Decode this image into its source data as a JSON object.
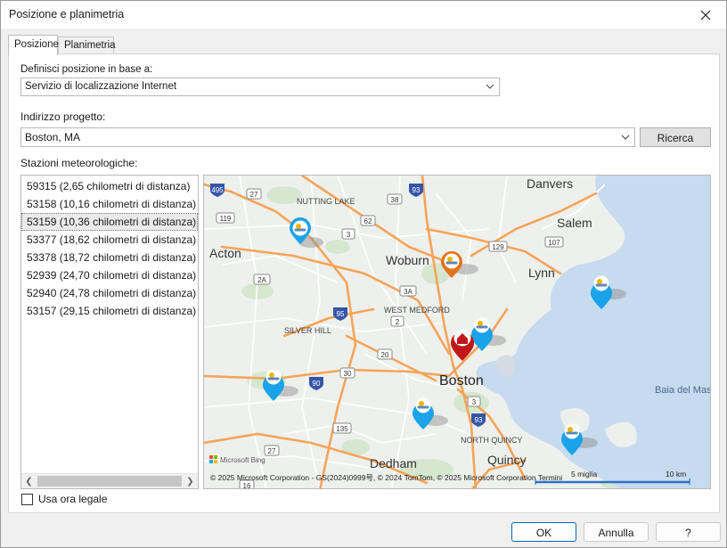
{
  "window": {
    "title": "Posizione e planimetria"
  },
  "tabs": [
    {
      "label": "Posizione"
    },
    {
      "label": "Planimetria"
    }
  ],
  "location": {
    "define_label": "Definisci posizione in base a:",
    "define_value": "Servizio di localizzazione Internet",
    "address_label": "Indirizzo progetto:",
    "address_value": "Boston, MA",
    "search_button": "Ricerca"
  },
  "stations": {
    "label": "Stazioni meteorologiche:",
    "items": [
      "59315 (2,65 chilometri di distanza)",
      "53158 (10,16 chilometri di distanza)",
      "53159 (10,36 chilometri di distanza)",
      "53377 (18,62 chilometri di distanza)",
      "53378 (18,72 chilometri di distanza)",
      "52939 (24,70 chilometri di distanza)",
      "52940 (24,78 chilometri di distanza)",
      "53157 (29,15 chilometri di distanza)"
    ],
    "selected_index": 2
  },
  "map": {
    "places": {
      "danvers": "Danvers",
      "salem": "Salem",
      "nutting_lake": "NUTTING LAKE",
      "acton": "Acton",
      "woburn": "Woburn",
      "lynn": "Lynn",
      "west_medford": "WEST MEDFORD",
      "silver_hill": "SILVER HILL",
      "boston": "Boston",
      "baia": "Baia del Mas",
      "north_quincy": "NORTH QUINCY",
      "dedham": "Dedham",
      "quincy": "Quincy"
    },
    "shields": {
      "i495": "495",
      "r27a": "27",
      "i93a": "93",
      "r38": "38",
      "r119": "119",
      "r62": "62",
      "r3a": "3",
      "r129": "129",
      "r107": "107",
      "r2a": "2A",
      "r3b": "3A",
      "i95": "95",
      "r2": "2",
      "r20": "20",
      "r30": "30",
      "i90": "90",
      "r3c": "3",
      "i93b": "93",
      "r135": "135",
      "r27b": "27",
      "r16": "16"
    },
    "logo": "Microsoft Bing",
    "copyright": "© 2025 Microsoft Corporation - GS(2024)0999号, © 2024 TomTom, © 2025 Microsoft Corporation   Termini",
    "scale_miles": "5 miglia",
    "scale_km": "10 km",
    "colors": {
      "water": "#c7dbef",
      "land": "#eef0ee",
      "major_road": "#f6a457",
      "minor_road": "#ffffff",
      "pin_blue": "#1aa3e8",
      "pin_orange": "#e2731c",
      "pin_red": "#c01818"
    }
  },
  "dst": {
    "label": "Usa ora legale",
    "checked": false
  },
  "footer": {
    "ok": "OK",
    "cancel": "Annulla",
    "help": "?"
  }
}
